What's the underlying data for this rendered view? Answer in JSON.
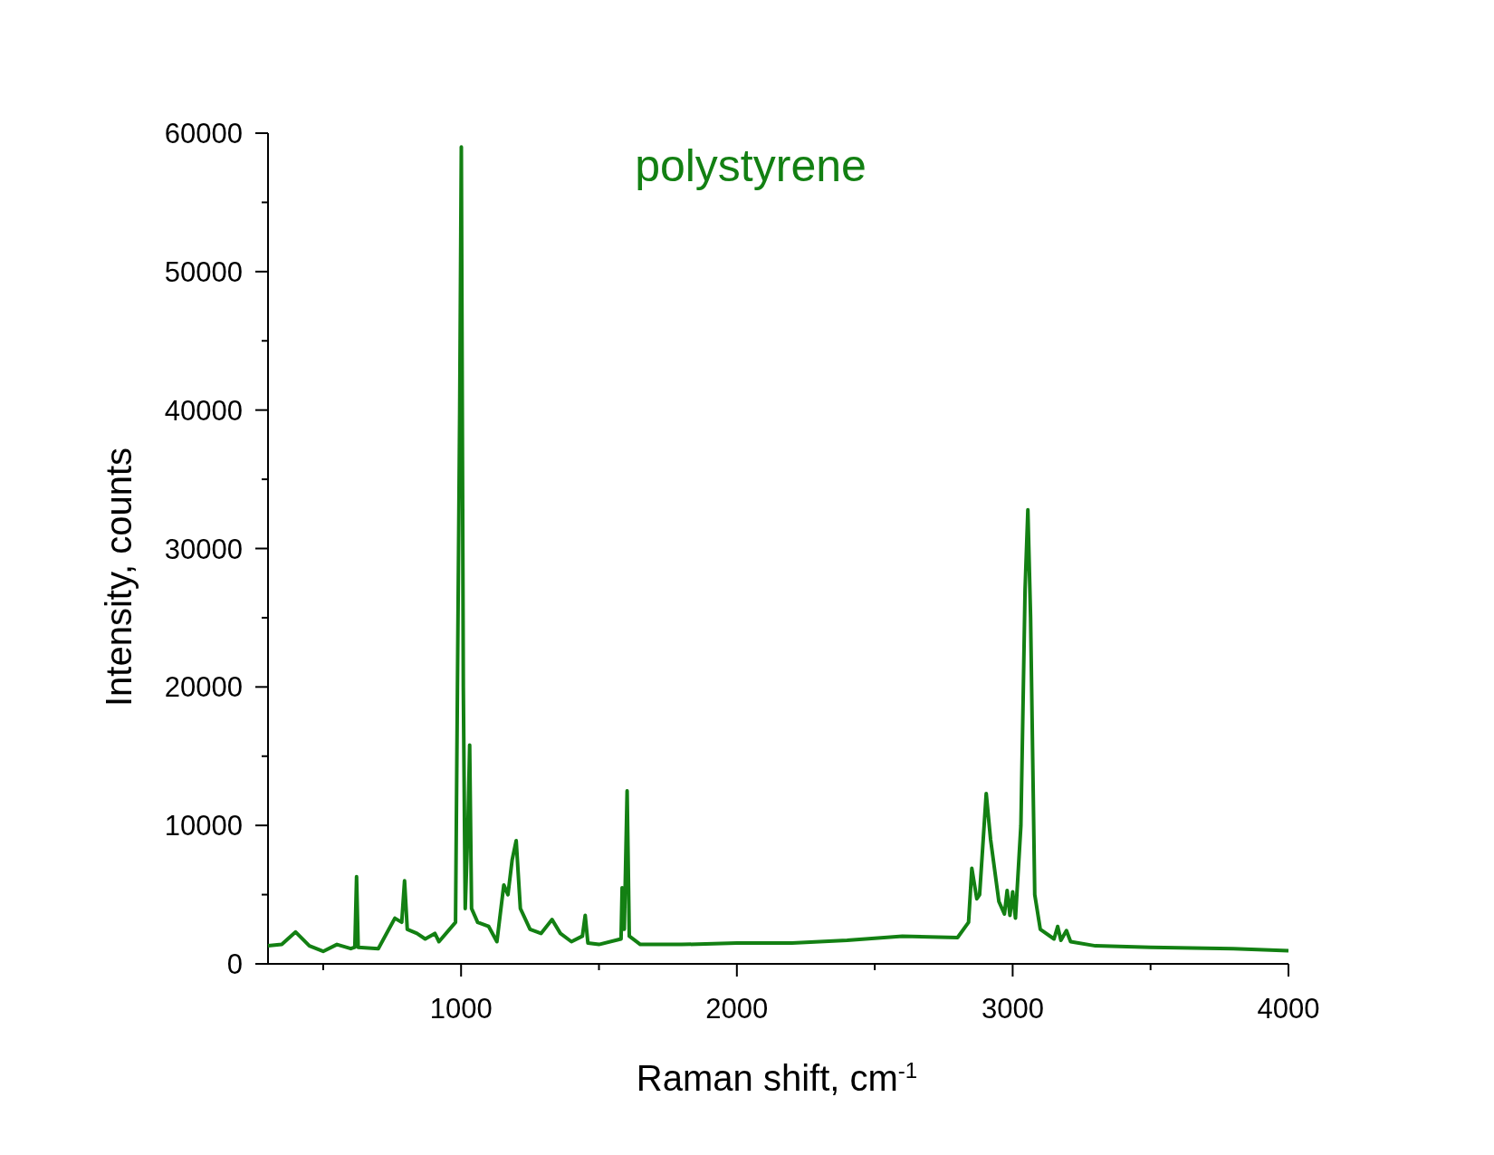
{
  "chart_data": {
    "type": "line",
    "title": "polystyrene",
    "xlabel": "Raman shift, cm$^{-1}$",
    "ylabel": "Intensity, counts",
    "xlim": [
      300,
      4000
    ],
    "ylim": [
      0,
      60000
    ],
    "xticks": [
      1000,
      2000,
      3000,
      4000
    ],
    "yticks": [
      0,
      10000,
      20000,
      30000,
      40000,
      50000,
      60000
    ],
    "x": [
      300,
      350,
      400,
      450,
      500,
      550,
      600,
      615,
      621,
      627,
      700,
      760,
      785,
      795,
      805,
      840,
      870,
      905,
      920,
      980,
      995,
      1001,
      1008,
      1015,
      1025,
      1031,
      1038,
      1060,
      1100,
      1130,
      1155,
      1170,
      1185,
      1200,
      1215,
      1250,
      1290,
      1330,
      1360,
      1400,
      1440,
      1450,
      1460,
      1500,
      1580,
      1584,
      1592,
      1602,
      1610,
      1650,
      1800,
      2000,
      2200,
      2400,
      2600,
      2800,
      2840,
      2852,
      2870,
      2880,
      2904,
      2920,
      2950,
      2970,
      2980,
      2990,
      3000,
      3010,
      3030,
      3045,
      3055,
      3065,
      3080,
      3100,
      3150,
      3163,
      3175,
      3195,
      3210,
      3300,
      3500,
      3800,
      4000
    ],
    "series": [
      {
        "color": "#138013",
        "values": [
          1300,
          1400,
          2300,
          1300,
          900,
          1400,
          1100,
          1200,
          6300,
          1200,
          1100,
          3300,
          3000,
          6000,
          2500,
          2200,
          1800,
          2200,
          1600,
          3000,
          40000,
          59000,
          20000,
          4000,
          10000,
          15800,
          4000,
          3000,
          2700,
          1600,
          5700,
          5000,
          7500,
          8900,
          4000,
          2500,
          2200,
          3200,
          2200,
          1600,
          2000,
          3500,
          1500,
          1400,
          1800,
          5500,
          2500,
          12500,
          2000,
          1400,
          1400,
          1500,
          1500,
          1700,
          2000,
          1900,
          3000,
          6900,
          4700,
          5000,
          12300,
          9000,
          4500,
          3600,
          5300,
          3500,
          5200,
          3300,
          10000,
          27000,
          32800,
          25000,
          5000,
          2500,
          1800,
          2700,
          1700,
          2400,
          1600,
          1300,
          1200,
          1100,
          950
        ]
      }
    ]
  }
}
